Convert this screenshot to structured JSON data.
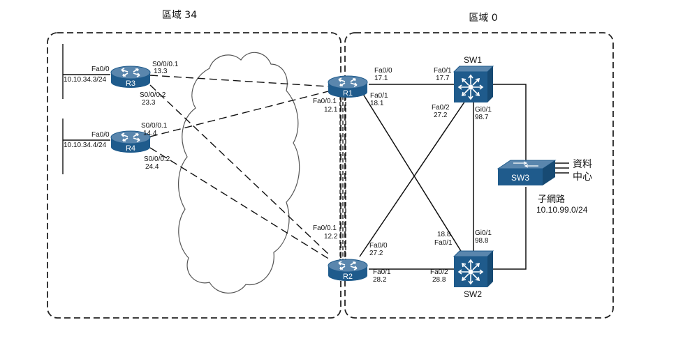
{
  "areas": {
    "area34": "區域 34",
    "area0": "區域 0"
  },
  "devices": {
    "r1": "R1",
    "r2": "R2",
    "r3": "R3",
    "r4": "R4",
    "sw1": "SW1",
    "sw2": "SW2",
    "sw3": "SW3"
  },
  "datacenter": {
    "line1": "資料",
    "line2": "中心"
  },
  "subnet": {
    "label": "子網路",
    "value": "10.10.99.0/24"
  },
  "labels": {
    "r3_fa00": "Fa0/0",
    "r3_ip": "10.10.34.3/24",
    "r3_s0001_name": "S0/0/0.1",
    "r3_s0001_ip": "13.3",
    "r3_s0002_name": "S0/0/0.2",
    "r3_s0002_ip": "23.3",
    "r4_fa00": "Fa0/0",
    "r4_ip": "10.10.34.4/24",
    "r4_s0001_name": "S0/0/0.1",
    "r4_s0001_ip": "14.4",
    "r4_s0002_name": "S0/0/0.2",
    "r4_s0002_ip": "24.4",
    "r1_fa00_name": "Fa0/0",
    "r1_fa00_ip": "17.1",
    "r1_fa01_name": "Fa0/1",
    "r1_fa01_ip": "18.1",
    "r1_fa001_name": "Fa0/0.1",
    "r1_fa001_ip": "12.1",
    "r2_fa001_name": "Fa0/0.1",
    "r2_fa001_ip": "12.2",
    "r2_fa00_name": "Fa0/0",
    "r2_fa00_ip": "27.2",
    "r2_fa01_name": "Fa0/1",
    "r2_fa01_ip": "28.2",
    "sw1_fa01_name": "Fa0/1",
    "sw1_fa01_ip": "17.7",
    "sw1_fa02_name": "Fa0/2",
    "sw1_fa02_ip": "27.2",
    "sw1_gi01_name": "Gi0/1",
    "sw1_gi01_ip": "98.7",
    "sw2_gi01_name": "Gi0/1",
    "sw2_gi01_ip": "98.8",
    "sw2_fa01_ip": "18.8",
    "sw2_fa01_name": "Fa0/1",
    "sw2_fa02_name": "Fa0/2",
    "sw2_fa02_ip": "28.8"
  },
  "colors": {
    "device_top": "#5a86ad",
    "device_body": "#1f5b8c",
    "line": "#111111",
    "border": "#222222"
  }
}
